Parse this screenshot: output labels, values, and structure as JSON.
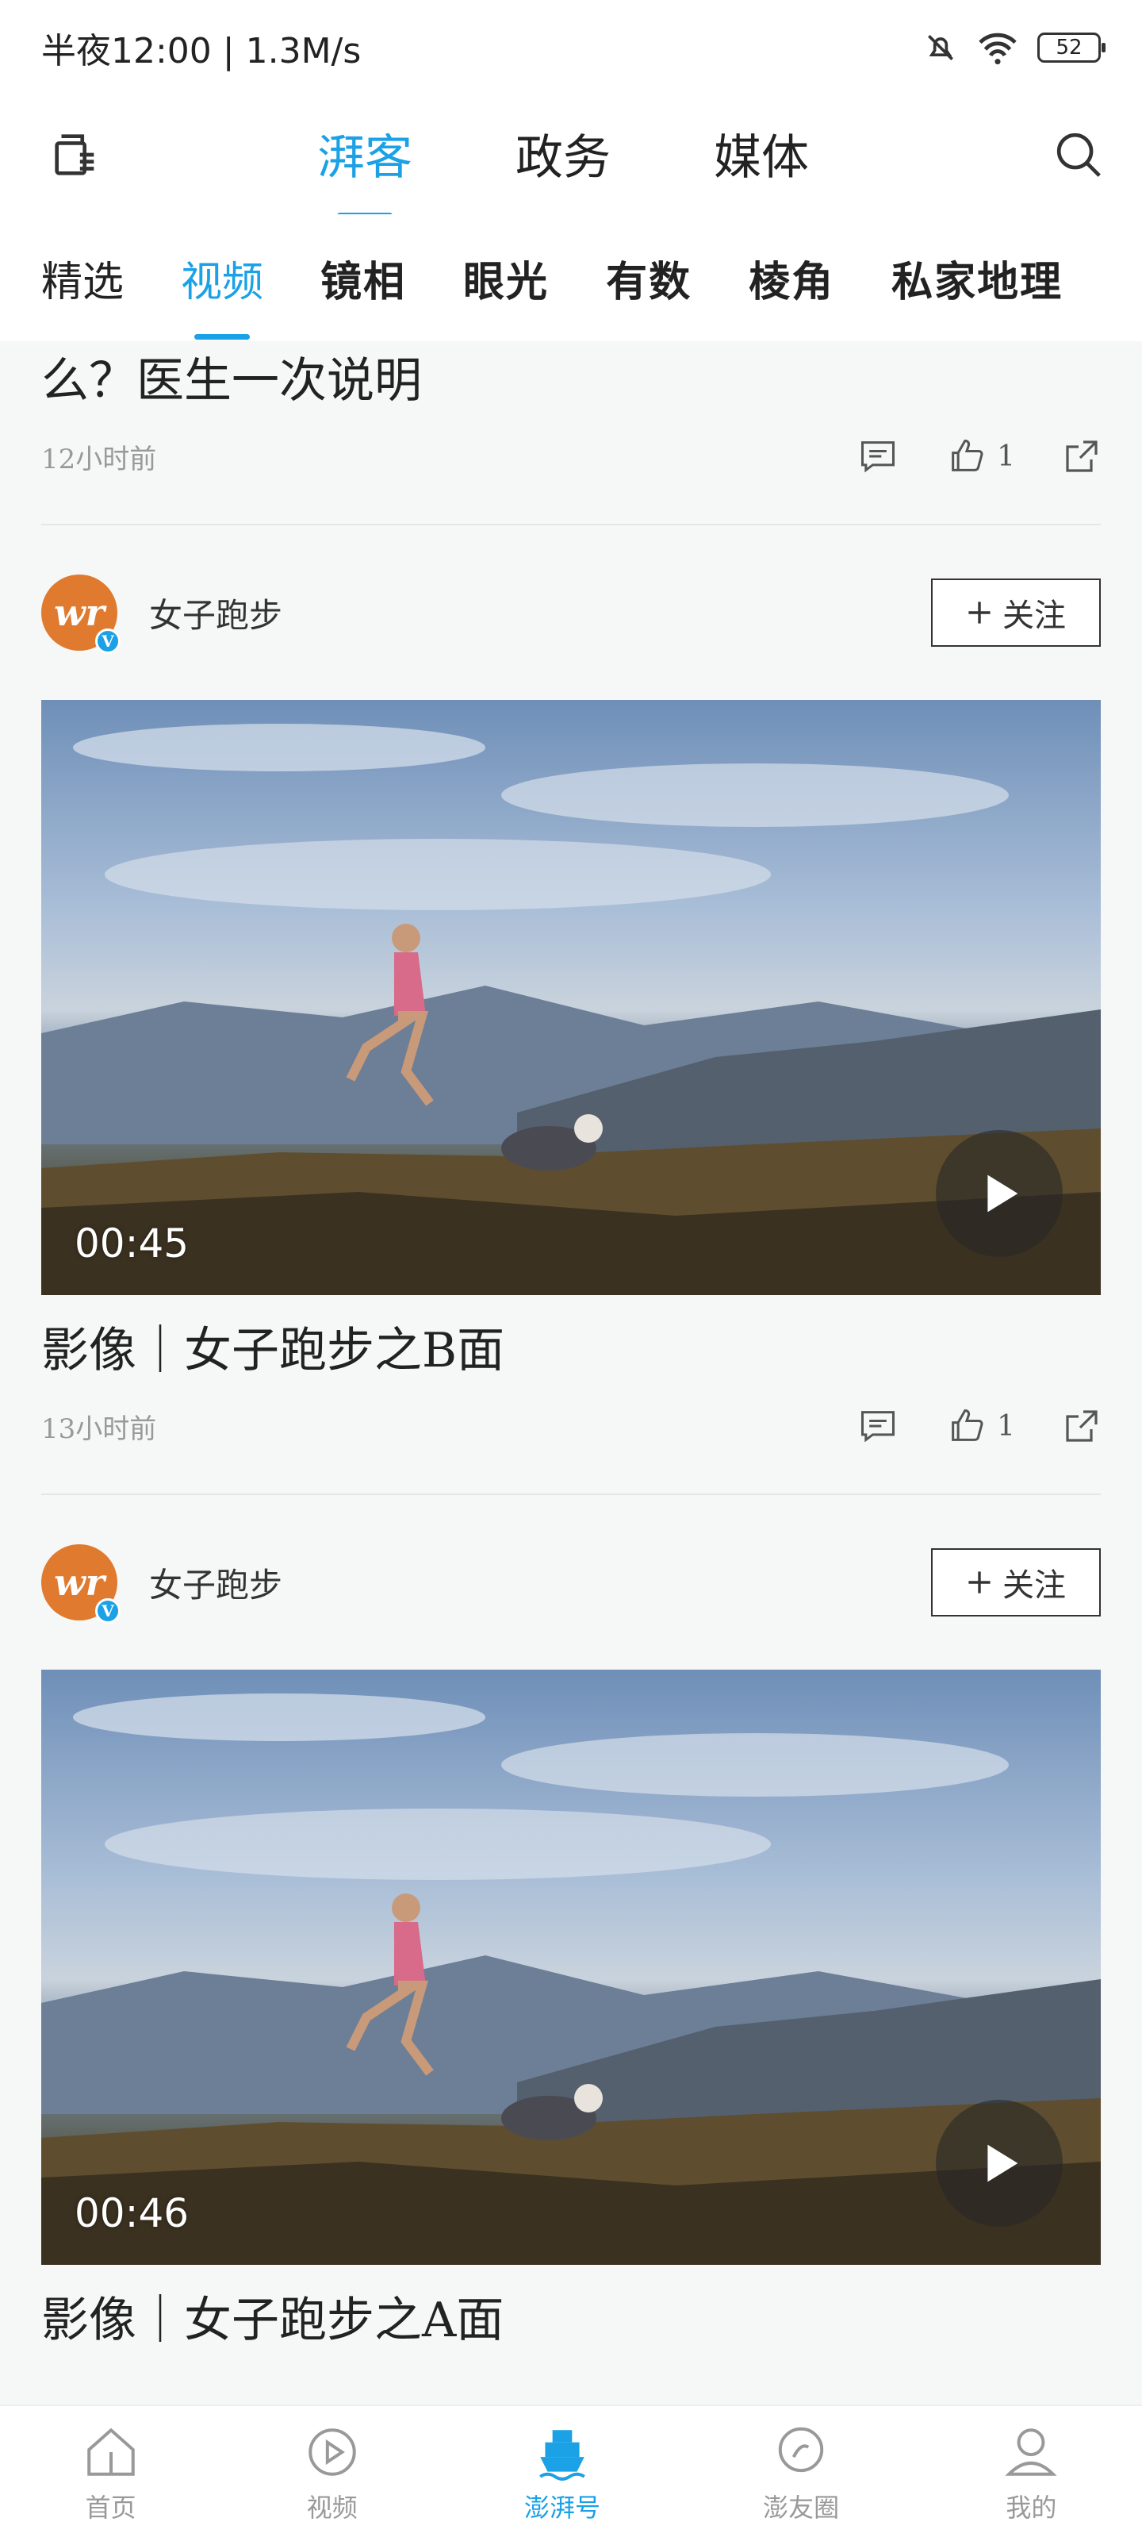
{
  "status_bar": {
    "time": "半夜12:00 | 1.3M/s",
    "battery": "52"
  },
  "top_nav": {
    "tabs": [
      {
        "label": "湃客",
        "active": true
      },
      {
        "label": "政务",
        "active": false
      },
      {
        "label": "媒体",
        "active": false
      }
    ]
  },
  "sub_tabs": [
    {
      "label": "精选",
      "active": false
    },
    {
      "label": "视频",
      "active": true
    },
    {
      "label": "镜相",
      "active": false
    },
    {
      "label": "眼光",
      "active": false
    },
    {
      "label": "有数",
      "active": false
    },
    {
      "label": "棱角",
      "active": false
    },
    {
      "label": "私家地理",
      "active": false
    }
  ],
  "articles": [
    {
      "title": "么？医生一次说明",
      "time": "12小时前",
      "likes": "1"
    }
  ],
  "video_cards": [
    {
      "author": "女子跑步",
      "follow_label": "关注",
      "duration": "00:45",
      "title": "影像｜女子跑步之B面",
      "time": "13小时前",
      "likes": "1"
    },
    {
      "author": "女子跑步",
      "follow_label": "关注",
      "duration": "00:46",
      "title": "影像｜女子跑步之A面"
    }
  ],
  "bottom_nav": [
    {
      "label": "首页",
      "icon": "home-icon",
      "active": false
    },
    {
      "label": "视频",
      "icon": "video-play-icon",
      "active": false
    },
    {
      "label": "澎湃号",
      "icon": "ship-icon",
      "active": true
    },
    {
      "label": "澎友圈",
      "icon": "chat-circle-icon",
      "active": false
    },
    {
      "label": "我的",
      "icon": "profile-icon",
      "active": false
    }
  ],
  "colors": {
    "accent": "#1aa1e6",
    "avatar": "#e07a2f"
  }
}
